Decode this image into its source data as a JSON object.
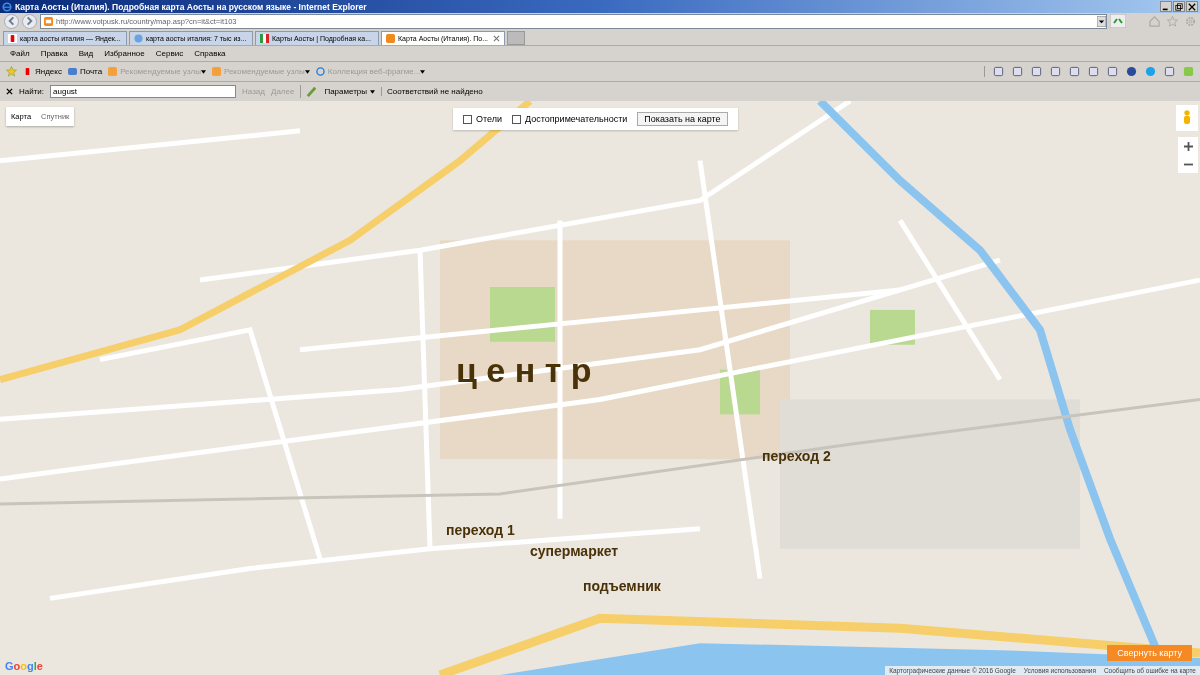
{
  "window": {
    "title": "Карта Аосты (Италия). Подробная карта Аосты на русском языке - Internet Explorer"
  },
  "address_bar": {
    "url": "http://www.votpusk.ru/country/map.asp?cn=it&ct=it103"
  },
  "tabs": [
    {
      "label": "карта аосты италия — Яндек...",
      "selected": false
    },
    {
      "label": "карта аосты италия: 7 тыс из...",
      "selected": false
    },
    {
      "label": "Карты Аосты | Подробная ка...",
      "selected": false
    },
    {
      "label": "Карта Аосты (Италия). По...",
      "selected": true
    }
  ],
  "menu": [
    "Файл",
    "Правка",
    "Вид",
    "Избранное",
    "Сервис",
    "Справка"
  ],
  "favorites": [
    {
      "label": "Яндекс",
      "disabled": false,
      "has_menu": false
    },
    {
      "label": "Почта",
      "disabled": false,
      "has_menu": false
    },
    {
      "label": "Рекомендуемые узлы",
      "disabled": true,
      "has_menu": true
    },
    {
      "label": "Рекомендуемые узлы",
      "disabled": true,
      "has_menu": true
    },
    {
      "label": "Коллекция веб-фрагме...",
      "disabled": true,
      "has_menu": true
    }
  ],
  "find_bar": {
    "label": "Найти:",
    "value": "august",
    "prev": "Назад",
    "next": "Далее",
    "options": "Параметры",
    "status": "Соответствий не найдено"
  },
  "map": {
    "type_buttons": [
      {
        "label": "Карта",
        "selected": true
      },
      {
        "label": "Спутник",
        "selected": false
      }
    ],
    "filters": [
      {
        "label": "Отели",
        "checked": false
      },
      {
        "label": "Достопримечательности",
        "checked": false
      }
    ],
    "show_button": "Показать на карте",
    "labels": [
      "ц е н т р",
      "переход 1",
      "переход 2",
      "супермаркет",
      "подъемник"
    ],
    "collapse_button": "Свернуть карту",
    "footer": [
      "Картографические данные © 2016 Google",
      "Условия использования",
      "Сообщить об ошибке на карте"
    ],
    "logo": "Google"
  }
}
